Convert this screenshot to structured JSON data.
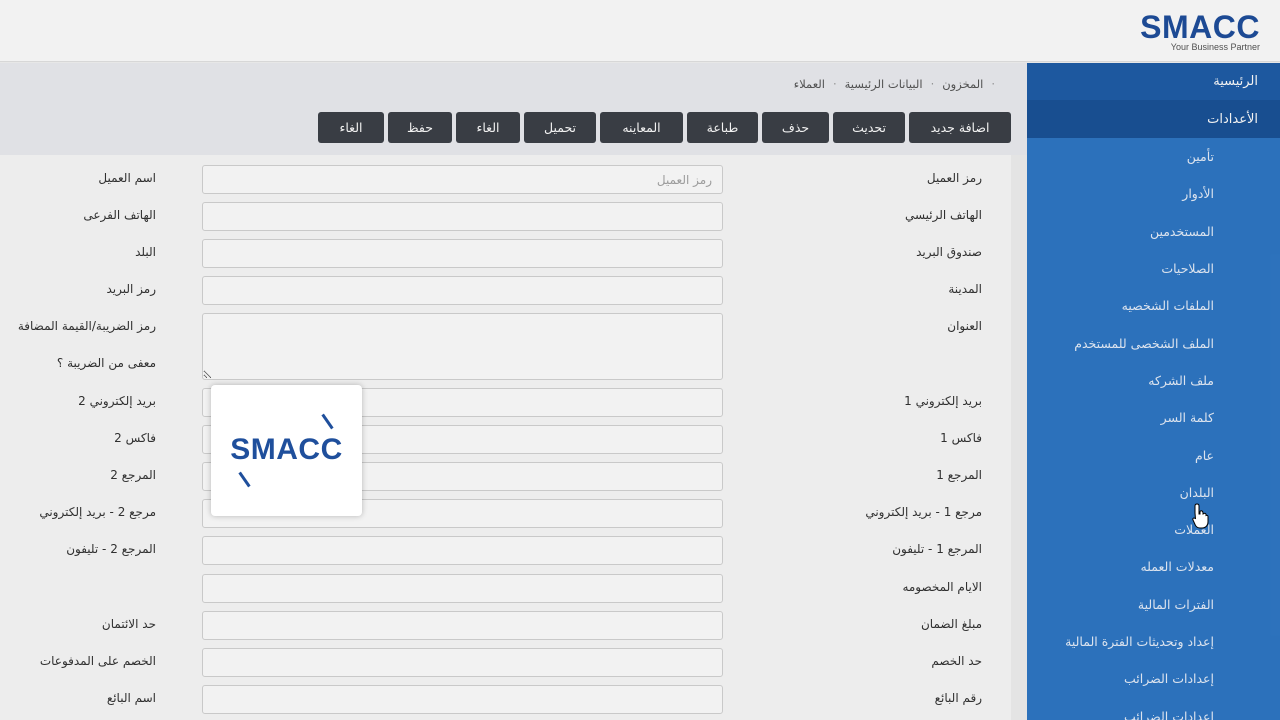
{
  "brand": {
    "logo": "SMACC",
    "tagline": "Your Business Partner"
  },
  "sidebar": {
    "home": "الرئيسية",
    "settings": "الأعدادات",
    "items": [
      "تأمين",
      "الأدوار",
      "المستخدمين",
      "الصلاحيات",
      "الملفات الشخصيه",
      "الملف الشخصى للمستخدم",
      "ملف الشركه",
      "كلمة السر",
      "عام",
      "البلدان",
      "العملات",
      "معدلات العمله",
      "الفترات المالية",
      "إعداد وتحديثات الفترة المالية",
      "إعدادات الضرائب",
      "إعدادات الضرائب"
    ]
  },
  "breadcrumb": [
    "المخزون",
    "البيانات الرئيسية",
    "العملاء"
  ],
  "toolbar": {
    "add": "اضافة جديد",
    "refresh": "تحديث",
    "delete": "حذف",
    "print": "طباعة",
    "preview": "المعاينه",
    "load": "تحميل",
    "cancel1": "الغاء",
    "save": "حفظ",
    "cancel2": "الغاء"
  },
  "form": {
    "right": {
      "customer_code": "رمز العميل",
      "main_phone": "الهاتف الرئيسي",
      "po_box": "صندوق البريد",
      "city": "المدينة",
      "address": "العنوان",
      "email1": "بريد إلكتروني 1",
      "fax1": "فاكس 1",
      "ref1": "المرجع 1",
      "ref1_email": "مرجع 1 - بريد إلكتروني",
      "ref1_phone": "المرجع 1 - تليفون",
      "discount_days": "الايام المخصومه",
      "guarantee_amount": "مبلغ الضمان",
      "discount_limit": "حد الخصم",
      "seller_number": "رقم البائع"
    },
    "left": {
      "customer_name": "اسم العميل",
      "sub_phone": "الهاتف الفرعى",
      "country": "البلد",
      "postal_code": "رمز البريد",
      "vat_code": "رمز الضريبة/القيمة المضافة",
      "tax_exempt": "معفى من الضريبة ؟",
      "email2": "بريد إلكتروني 2",
      "fax2": "فاكس 2",
      "ref2": "المرجع 2",
      "ref2_email": "مرجع 2 - بريد إلكتروني",
      "ref2_phone": "المرجع 2 - تليفون",
      "credit_limit": "حد الائتمان",
      "payment_discount": "الخصم على المدفوعات",
      "seller_name": "اسم البائع"
    },
    "customer_code_placeholder": "رمز العميل"
  },
  "loading": {
    "logo": "SMACC"
  }
}
